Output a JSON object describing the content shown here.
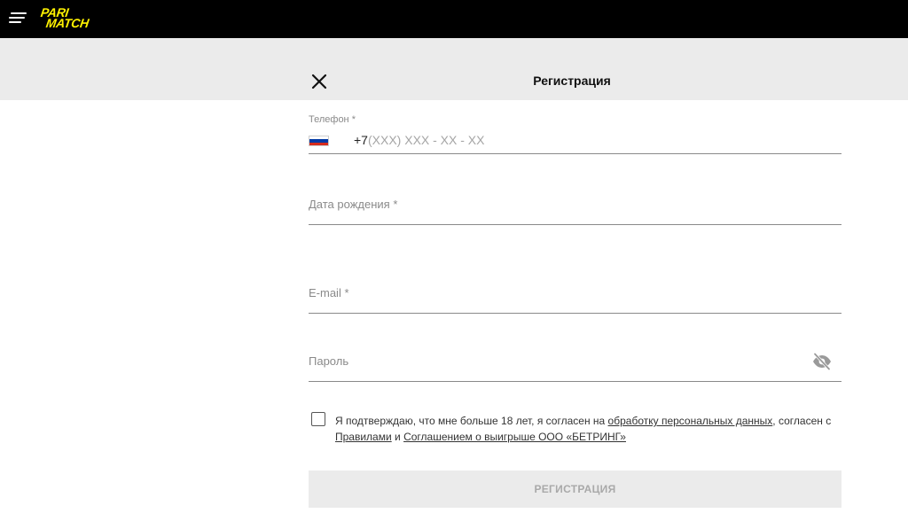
{
  "header": {
    "logo_line1": "PARI",
    "logo_line2": "MATCH",
    "brand_color": "#fff200",
    "background": "#000000"
  },
  "dialog": {
    "title": "Регистрация"
  },
  "form": {
    "phone": {
      "label": "Телефон *",
      "country_flag": "ru-flag-icon",
      "prefix": "+7",
      "placeholder": "(XXX) XXX - XX - XX"
    },
    "birthdate": {
      "label": "Дата рождения *"
    },
    "email": {
      "label": "E-mail *"
    },
    "password": {
      "label": "Пароль",
      "toggle_icon": "eye-off-icon"
    },
    "agreement": {
      "text_1": "Я подтверждаю, что мне больше 18 лет, я согласен на ",
      "link_1": "обработку персональных данных",
      "text_2": ", согласен с ",
      "link_2": "Правилами",
      "text_3": " и ",
      "link_3": "Соглашением о выигрыше ООО «БЕТРИНГ»",
      "checked": false
    },
    "submit_label": "РЕГИСТРАЦИЯ"
  }
}
